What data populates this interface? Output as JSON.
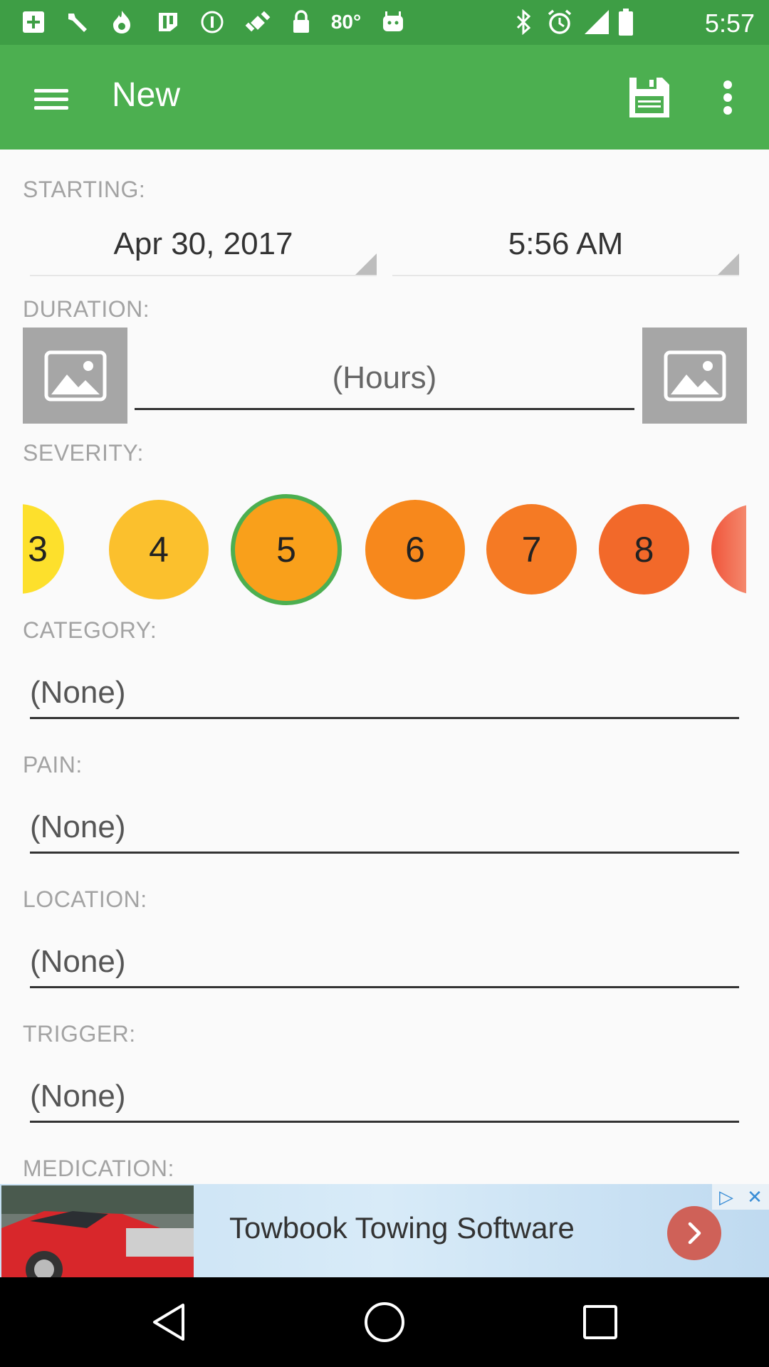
{
  "status_bar": {
    "temperature": "80°",
    "time": "5:57",
    "left_icons": [
      "add-icon",
      "wrench-icon",
      "flame-icon",
      "slack-icon",
      "circle-icon",
      "satellite-fake-gps-icon",
      "lock-icon"
    ],
    "right_icons": [
      "bluetooth-icon",
      "alarm-icon",
      "signal-icon",
      "battery-icon"
    ]
  },
  "app_bar": {
    "title": "New",
    "background": "#4caf50",
    "status_background": "#3e9e45"
  },
  "form": {
    "starting_label": "STARTING:",
    "date": "Apr 30, 2017",
    "time": "5:56 AM",
    "duration_label": "DURATION:",
    "duration_placeholder": "(Hours)",
    "severity_label": "SEVERITY:",
    "severity": {
      "selected": "5",
      "levels": [
        {
          "label": "3",
          "color": "#fde02c"
        },
        {
          "label": "4",
          "color": "#fbc02d"
        },
        {
          "label": "5",
          "color": "#f9a01b",
          "ring": "#4caf50"
        },
        {
          "label": "6",
          "color": "#f7881c"
        },
        {
          "label": "7",
          "color": "#f57a24"
        },
        {
          "label": "8",
          "color": "#f2692a"
        },
        {
          "label": "",
          "color": "#f0553a"
        }
      ]
    },
    "category_label": "CATEGORY:",
    "category_value": "(None)",
    "pain_label": "PAIN:",
    "pain_value": "(None)",
    "location_label": "LOCATION:",
    "location_value": "(None)",
    "trigger_label": "TRIGGER:",
    "trigger_value": "(None)",
    "medication_label": "MEDICATION:"
  },
  "ad": {
    "text": "Towbook Towing Software"
  }
}
